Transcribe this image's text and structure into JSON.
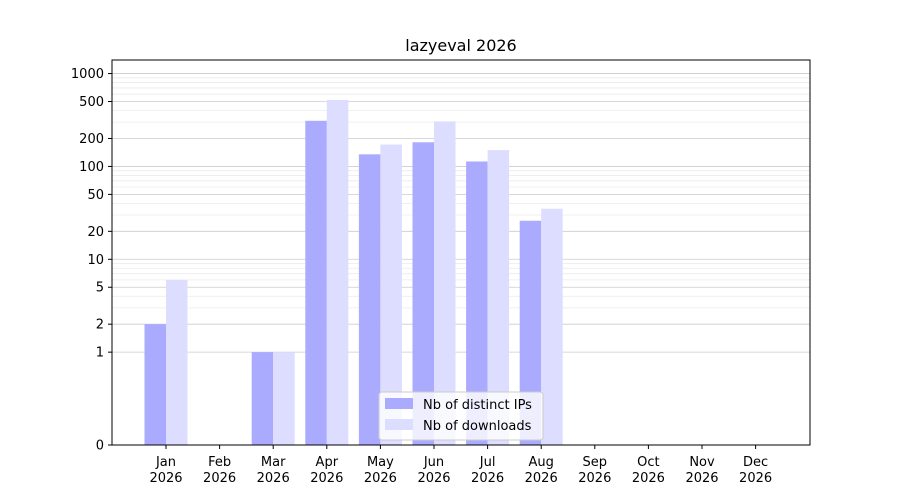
{
  "chart_data": {
    "type": "bar",
    "title": "lazyeval 2026",
    "xlabel": "",
    "ylabel": "",
    "categories": [
      {
        "month": "Jan",
        "year": "2026"
      },
      {
        "month": "Feb",
        "year": "2026"
      },
      {
        "month": "Mar",
        "year": "2026"
      },
      {
        "month": "Apr",
        "year": "2026"
      },
      {
        "month": "May",
        "year": "2026"
      },
      {
        "month": "Jun",
        "year": "2026"
      },
      {
        "month": "Jul",
        "year": "2026"
      },
      {
        "month": "Aug",
        "year": "2026"
      },
      {
        "month": "Sep",
        "year": "2026"
      },
      {
        "month": "Oct",
        "year": "2026"
      },
      {
        "month": "Nov",
        "year": "2026"
      },
      {
        "month": "Dec",
        "year": "2026"
      }
    ],
    "series": [
      {
        "name": "Nb of distinct IPs",
        "color": "#aaaaff",
        "values": [
          2,
          0,
          1,
          310,
          135,
          182,
          113,
          26,
          0,
          0,
          0,
          0
        ]
      },
      {
        "name": "Nb of downloads",
        "color": "#ddddff",
        "values": [
          6,
          0,
          1,
          520,
          172,
          305,
          150,
          35,
          0,
          0,
          0,
          0
        ]
      }
    ],
    "y_scale": "symlog",
    "y_ticks": [
      0,
      1,
      2,
      5,
      10,
      20,
      50,
      100,
      200,
      500,
      1000
    ],
    "y_tick_labels": [
      "0",
      "1",
      "2",
      "5",
      "10",
      "20",
      "50",
      "100",
      "200",
      "500",
      "1000"
    ],
    "ylim": [
      0,
      1400
    ],
    "grid": true,
    "legend_position": "lower-center"
  }
}
